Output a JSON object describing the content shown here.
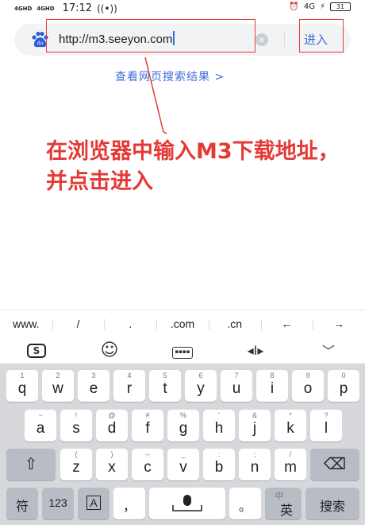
{
  "status_bar": {
    "signal_1": "4GHD",
    "signal_2": "4GHD",
    "time": "17:12",
    "network": "4G",
    "battery": "31"
  },
  "search_bar": {
    "url": "http://m3.seeyon.com",
    "go_label": "进入"
  },
  "web_results_link": "查看网页搜索结果 >",
  "annotation": {
    "text": "在浏览器中输入M3下载地址，并点击进入",
    "color": "#e53935"
  },
  "quick_keys": [
    "www.",
    "/",
    ".",
    ".com",
    ".cn",
    "←",
    "→"
  ],
  "toolbar": {
    "items": [
      "sogou-logo-icon",
      "emoji-icon",
      "keyboard-icon",
      "cursor-move-icon",
      "collapse-keyboard-icon"
    ],
    "sogou": "S",
    "emoji": "☺",
    "cursor": "◂I▸",
    "collapse": "﹀"
  },
  "keyboard": {
    "row1": [
      {
        "key": "q",
        "hint": "1"
      },
      {
        "key": "w",
        "hint": "2"
      },
      {
        "key": "e",
        "hint": "3"
      },
      {
        "key": "r",
        "hint": "4"
      },
      {
        "key": "t",
        "hint": "5"
      },
      {
        "key": "y",
        "hint": "6"
      },
      {
        "key": "u",
        "hint": "7"
      },
      {
        "key": "i",
        "hint": "8"
      },
      {
        "key": "o",
        "hint": "9"
      },
      {
        "key": "p",
        "hint": "0"
      }
    ],
    "row2": [
      {
        "key": "a",
        "hint": "~"
      },
      {
        "key": "s",
        "hint": "!"
      },
      {
        "key": "d",
        "hint": "@"
      },
      {
        "key": "f",
        "hint": "#"
      },
      {
        "key": "g",
        "hint": "%"
      },
      {
        "key": "h",
        "hint": "'"
      },
      {
        "key": "j",
        "hint": "&"
      },
      {
        "key": "k",
        "hint": "*"
      },
      {
        "key": "l",
        "hint": "?"
      }
    ],
    "row3": [
      {
        "key": "z",
        "hint": "("
      },
      {
        "key": "x",
        "hint": ")"
      },
      {
        "key": "c",
        "hint": "–"
      },
      {
        "key": "v",
        "hint": "_"
      },
      {
        "key": "b",
        "hint": ":"
      },
      {
        "key": "n",
        "hint": ";"
      },
      {
        "key": "m",
        "hint": "/"
      }
    ],
    "shift": "⇧",
    "backspace": "⌫",
    "symbols": "符",
    "numbers": "123",
    "caps": "A",
    "comma": "，",
    "period": "。",
    "lang_hint": "中",
    "lang": "英",
    "search": "搜索"
  }
}
